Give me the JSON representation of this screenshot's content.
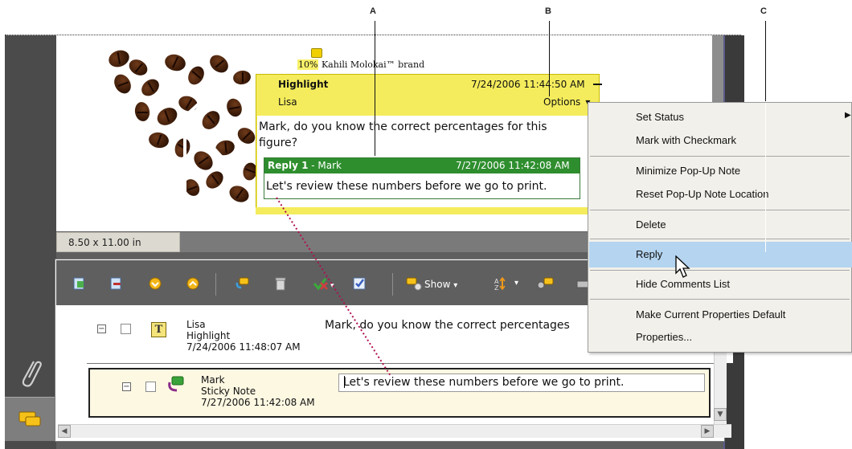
{
  "callouts": {
    "a": "A",
    "b": "B",
    "c": "C"
  },
  "document": {
    "page_size": "8.50 x 11.00 in",
    "brand_percent": "10%",
    "brand_text": "Kahili Molokai™ brand"
  },
  "popup": {
    "type": "Highlight",
    "datetime": "7/24/2006 11:44:50 AM",
    "author": "Lisa",
    "options_label": "Options",
    "text": "Mark, do you know the correct percentages for this figure?",
    "reply": {
      "title": "Reply 1",
      "author_sep": " - Mark",
      "datetime": "7/27/2006 11:42:08 AM",
      "text": "Let's review these numbers before we go to print."
    }
  },
  "comments_toolbar": {
    "show_label": "Show",
    "show_caret": "▾",
    "sort_caret": "▾"
  },
  "comments_list": [
    {
      "author": "Lisa",
      "type": "Highlight",
      "datetime": "7/24/2006 11:48:07 AM",
      "text": "Mark, do you know the correct percentages"
    },
    {
      "author": "Mark",
      "type": "Sticky Note",
      "datetime": "7/27/2006 11:42:08 AM",
      "text": "Let's review these numbers before we go to print."
    }
  ],
  "context_menu": {
    "items": [
      "Set Status",
      "Mark with Checkmark",
      "Minimize Pop-Up Note",
      "Reset Pop-Up Note Location",
      "Delete",
      "Reply",
      "Hide Comments List",
      "Make Current Properties Default",
      "Properties..."
    ],
    "highlighted": "Reply"
  },
  "colors": {
    "popup_yellow": "#f4ec5c",
    "reply_green": "#2e8e2e",
    "menu_highlight": "#b4d4f0",
    "panel_gray": "#5f5f5f"
  }
}
